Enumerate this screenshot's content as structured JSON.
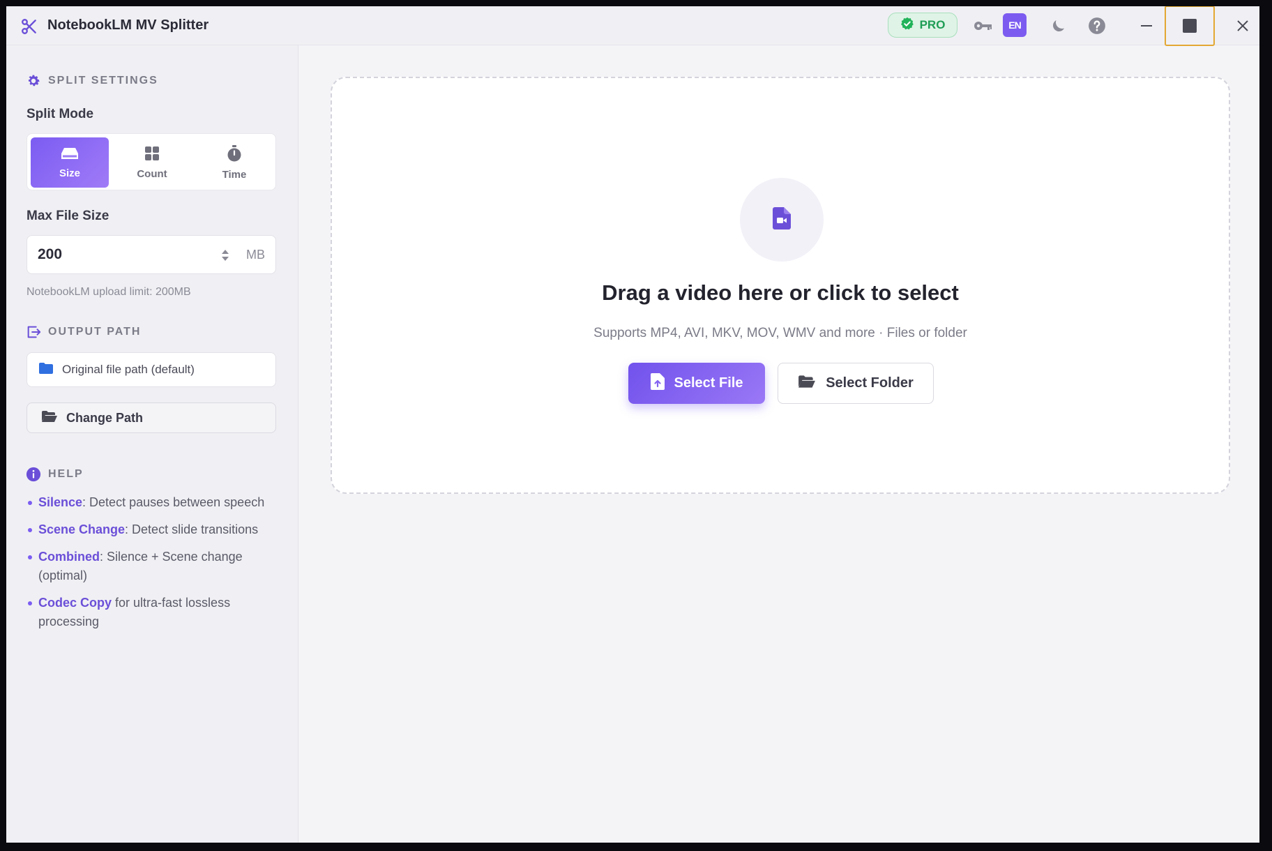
{
  "app": {
    "title": "NotebookLM MV Splitter",
    "icon": "scissors-icon"
  },
  "titlebar": {
    "pro_label": "PRO",
    "lang_label": "EN",
    "icons": [
      "check-badge-icon",
      "key-icon",
      "moon-icon",
      "help-icon",
      "minimize-icon",
      "maximize-icon",
      "close-icon"
    ]
  },
  "sidebar": {
    "split_settings_title": "SPLIT SETTINGS",
    "split_mode_label": "Split Mode",
    "modes": [
      {
        "label": "Size",
        "icon": "hdd-icon",
        "active": true
      },
      {
        "label": "Count",
        "icon": "grid-icon",
        "active": false
      },
      {
        "label": "Time",
        "icon": "stopwatch-icon",
        "active": false
      }
    ],
    "max_file_size_label": "Max File Size",
    "max_file_size_value": "200",
    "max_file_size_unit": "MB",
    "upload_hint": "NotebookLM upload limit: 200MB",
    "output_path_title": "OUTPUT PATH",
    "output_path_value": "Original file path (default)",
    "change_path_label": "Change Path",
    "help_title": "HELP",
    "help_items": [
      {
        "keyword": "Silence",
        "text": ": Detect pauses between speech"
      },
      {
        "keyword": "Scene Change",
        "text": ": Detect slide transitions"
      },
      {
        "keyword": "Combined",
        "text": ": Silence + Scene change (optimal)"
      },
      {
        "keyword": "Codec Copy",
        "text": " for ultra-fast lossless processing"
      }
    ]
  },
  "dropzone": {
    "title": "Drag a video here or click to select",
    "subtitle": "Supports MP4, AVI, MKV, MOV, WMV and more · Files or folder",
    "select_file_label": "Select File",
    "select_folder_label": "Select Folder"
  },
  "colors": {
    "accent": "#7b5cf2",
    "pro_green": "#1f9d55",
    "focus_outline": "#e3a733"
  }
}
